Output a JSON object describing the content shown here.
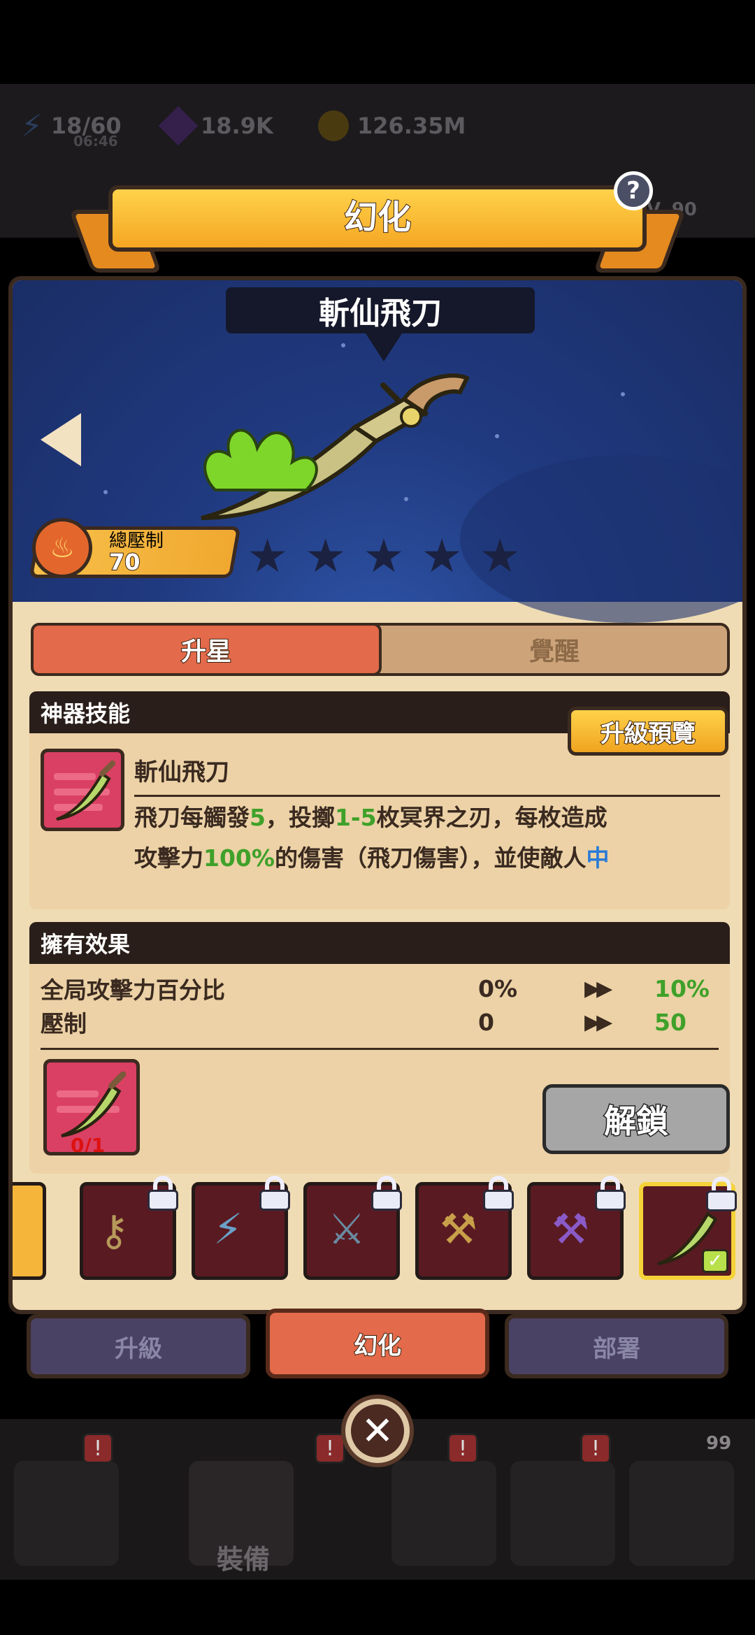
{
  "hud": {
    "energy": "18/60",
    "energy_timer": "06:46",
    "gems": "18.9K",
    "coins": "126.35M",
    "level_hint": "V. 90"
  },
  "modal": {
    "title": "幻化",
    "help": "?",
    "weapon_name": "斬仙飛刀",
    "power_label": "總壓制",
    "power_value": "70",
    "stars_filled": 0,
    "stars_total": 5
  },
  "tabs": [
    {
      "label": "升星",
      "active": true
    },
    {
      "label": "覺醒",
      "active": false
    }
  ],
  "skill": {
    "header": "神器技能",
    "name": "斬仙飛刀",
    "preview_button": "升級預覽",
    "desc_parts": [
      {
        "text": "飛刀每觸發",
        "c": ""
      },
      {
        "text": "5",
        "c": "g"
      },
      {
        "text": "，投擲",
        "c": ""
      },
      {
        "text": "1-5",
        "c": "g"
      },
      {
        "text": "枚冥界之刃，每枚造成",
        "c": ""
      }
    ],
    "desc_parts2": [
      {
        "text": "攻擊力",
        "c": ""
      },
      {
        "text": "100%",
        "c": "g"
      },
      {
        "text": "的傷害（飛刀傷害），並使敵人",
        "c": ""
      },
      {
        "text": "中",
        "c": "b"
      }
    ]
  },
  "effects": {
    "header": "擁有效果",
    "rows": [
      {
        "label": "全局攻擊力百分比",
        "current": "0%",
        "next": "10%"
      },
      {
        "label": "壓制",
        "current": "0",
        "next": "50"
      }
    ],
    "shard_count": "0/1",
    "unlock_button": "解鎖"
  },
  "nav": {
    "upgrade": "升級",
    "transform": "幻化",
    "deploy": "部署"
  },
  "bottom": {
    "equip_label": "裝備",
    "badge_count": "99"
  },
  "colors": {
    "accent": "#e36a4a",
    "gold": "#f5a623",
    "highlight_green": "#3fa12a"
  }
}
